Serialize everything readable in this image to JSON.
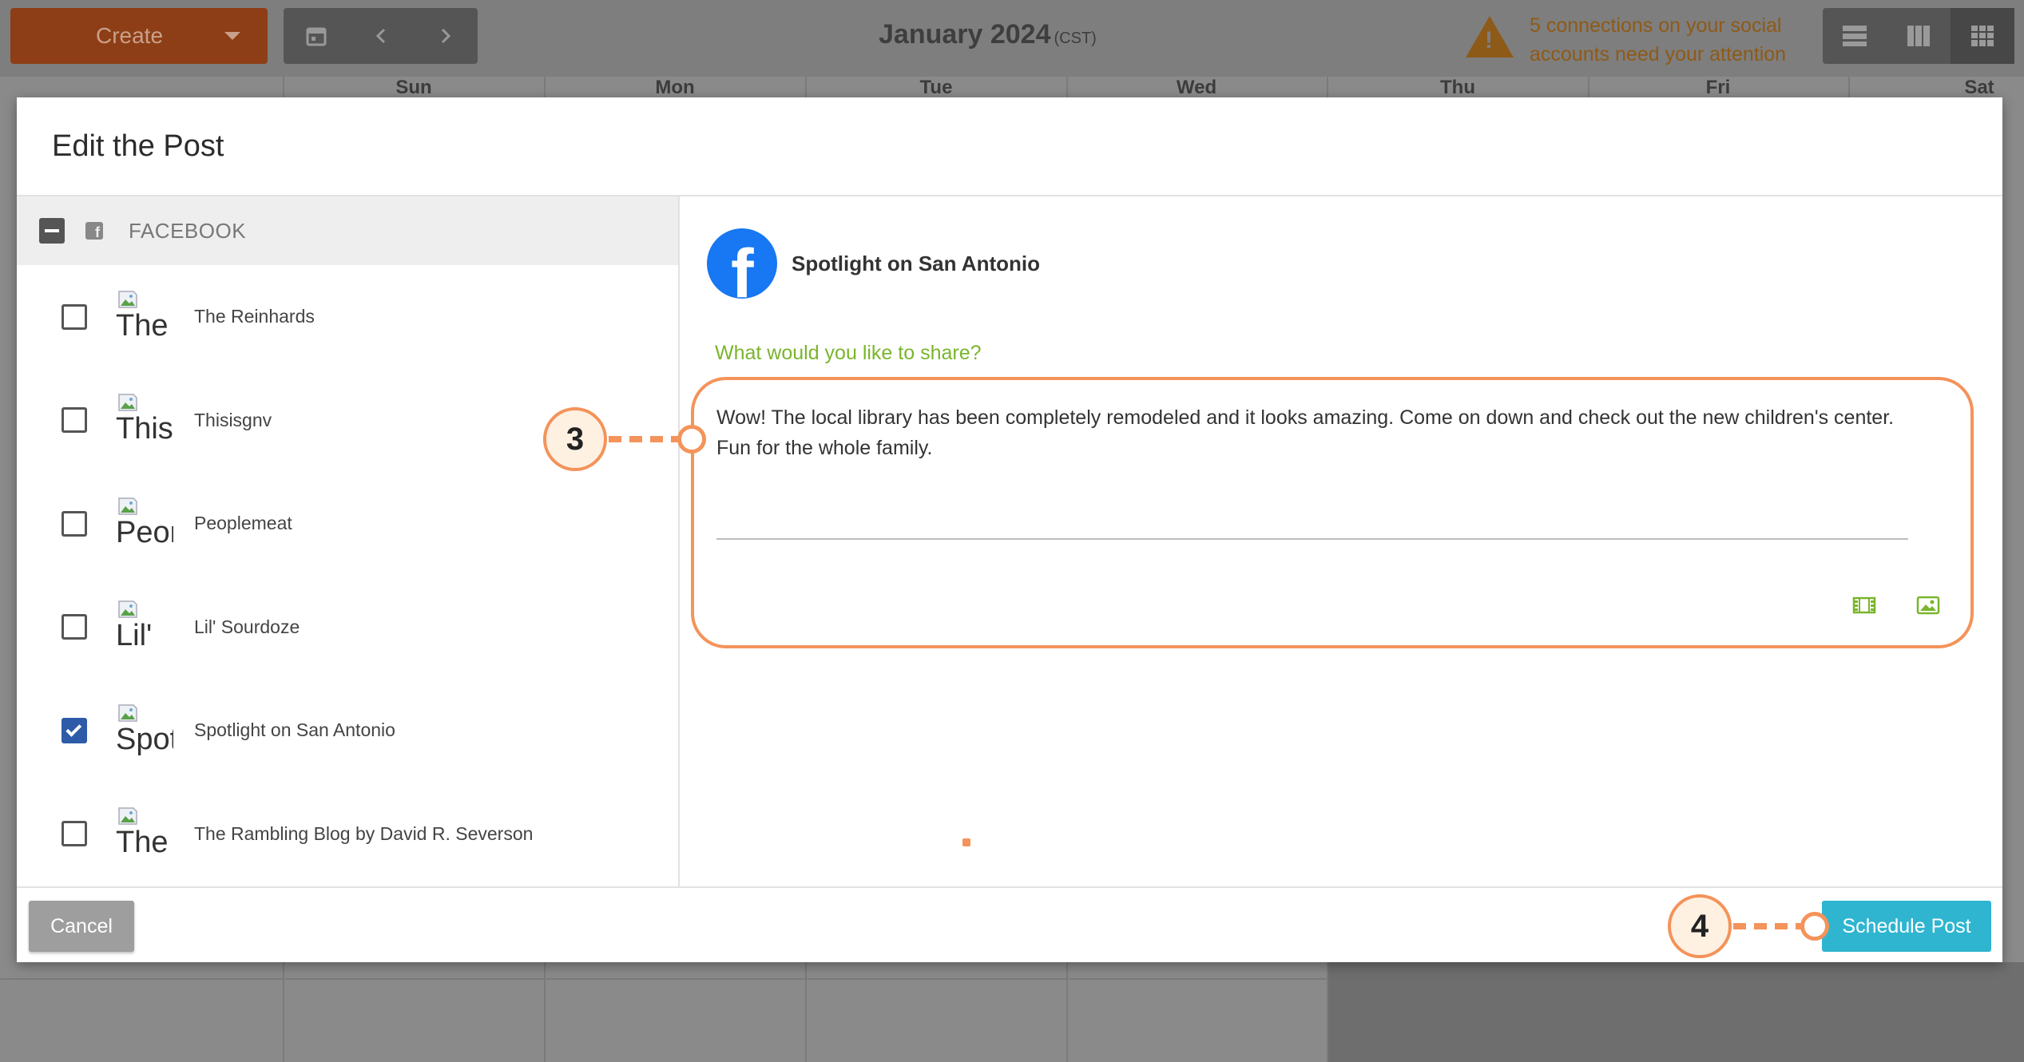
{
  "toolbar": {
    "create_label": "Create",
    "month": "January 2024",
    "timezone": "(CST)",
    "warning": "5 connections on your social accounts need your attention"
  },
  "calendar": {
    "days": [
      "Sun",
      "Mon",
      "Tue",
      "Wed",
      "Thu",
      "Fri",
      "Sat"
    ]
  },
  "modal": {
    "title": "Edit the Post",
    "group_label": "FACEBOOK",
    "accounts": [
      {
        "name": "The Reinhards",
        "alt": "The",
        "checked": false
      },
      {
        "name": "Thisisgnv",
        "alt": "Thisi",
        "checked": false
      },
      {
        "name": "Peoplemeat",
        "alt": "Peor",
        "checked": false
      },
      {
        "name": "Lil' Sourdoze",
        "alt": "Lil'",
        "checked": false
      },
      {
        "name": "Spotlight on San Antonio",
        "alt": "Spot",
        "checked": true
      },
      {
        "name": "The Rambling Blog by David R. Severson",
        "alt": "The",
        "checked": false
      }
    ],
    "page_name": "Spotlight on San Antonio",
    "share_label": "What would you like to share?",
    "post_text": "Wow! The local library has been completely remodeled and it looks amazing. Come on down and check out the new children's center. Fun for the whole family.",
    "cancel_label": "Cancel",
    "schedule_label": "Schedule Post"
  },
  "callouts": {
    "step3": "3",
    "step4": "4"
  },
  "colors": {
    "accent_orange": "#f4935a",
    "share_green": "#7ab52c",
    "schedule_blue": "#2fb5d0",
    "facebook_blue": "#1877f2",
    "checkbox_blue": "#2d5ba8"
  },
  "icons": {
    "create_menu": "chevron-down-icon",
    "calendar_nav": [
      "calendar-icon",
      "chevron-left-icon",
      "chevron-right-icon"
    ],
    "warning": "warning-icon",
    "views": [
      "list-view-icon",
      "week-view-icon",
      "month-view-icon"
    ],
    "facebook": "facebook-icon",
    "media": [
      "video-icon",
      "image-icon"
    ]
  }
}
